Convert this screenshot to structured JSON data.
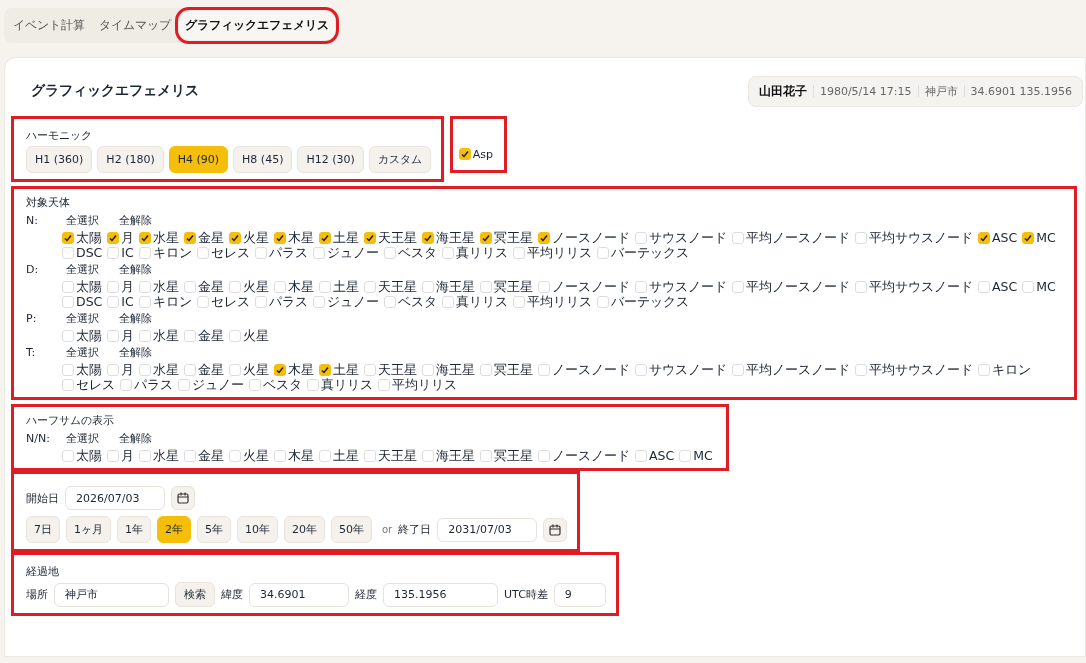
{
  "tabs": [
    {
      "label": "イベント計算",
      "selected": false,
      "highlighted": false
    },
    {
      "label": "タイムマップ",
      "selected": false,
      "highlighted": false
    },
    {
      "label": "グラフィックエフェメリス",
      "selected": true,
      "highlighted": true
    }
  ],
  "page_title": "グラフィックエフェメリス",
  "profile": {
    "name": "山田花子",
    "datetime": "1980/5/14 17:15",
    "place": "神戸市",
    "coords": "34.6901 135.1956"
  },
  "harmonic": {
    "label": "ハーモニック",
    "highlighted": true,
    "options": [
      {
        "label": "H1 (360)",
        "selected": false
      },
      {
        "label": "H2 (180)",
        "selected": false
      },
      {
        "label": "H4 (90)",
        "selected": true
      },
      {
        "label": "H8 (45)",
        "selected": false
      },
      {
        "label": "H12 (30)",
        "selected": false
      },
      {
        "label": "カスタム",
        "selected": false
      }
    ]
  },
  "asp": {
    "label": "Asp",
    "checked": true,
    "highlighted": true
  },
  "bodies": {
    "label": "対象天体",
    "highlighted": true,
    "groups": [
      {
        "label": "N:",
        "select_all": "全選択",
        "clear_all": "全解除",
        "items": [
          {
            "label": "太陽",
            "checked": true
          },
          {
            "label": "月",
            "checked": true
          },
          {
            "label": "水星",
            "checked": true
          },
          {
            "label": "金星",
            "checked": true
          },
          {
            "label": "火星",
            "checked": true
          },
          {
            "label": "木星",
            "checked": true
          },
          {
            "label": "土星",
            "checked": true
          },
          {
            "label": "天王星",
            "checked": true
          },
          {
            "label": "海王星",
            "checked": true
          },
          {
            "label": "冥王星",
            "checked": true
          },
          {
            "label": "ノースノード",
            "checked": true
          },
          {
            "label": "サウスノード",
            "checked": false
          },
          {
            "label": "平均ノースノード",
            "checked": false
          },
          {
            "label": "平均サウスノード",
            "checked": false
          },
          {
            "label": "ASC",
            "checked": true
          },
          {
            "label": "MC",
            "checked": true
          },
          {
            "label": "DSC",
            "checked": false
          },
          {
            "label": "IC",
            "checked": false
          },
          {
            "label": "キロン",
            "checked": false
          },
          {
            "label": "セレス",
            "checked": false
          },
          {
            "label": "パラス",
            "checked": false
          },
          {
            "label": "ジュノー",
            "checked": false
          },
          {
            "label": "ベスタ",
            "checked": false
          },
          {
            "label": "真リリス",
            "checked": false
          },
          {
            "label": "平均リリス",
            "checked": false
          },
          {
            "label": "バーテックス",
            "checked": false
          }
        ]
      },
      {
        "label": "D:",
        "select_all": "全選択",
        "clear_all": "全解除",
        "items": [
          {
            "label": "太陽",
            "checked": false
          },
          {
            "label": "月",
            "checked": false
          },
          {
            "label": "水星",
            "checked": false
          },
          {
            "label": "金星",
            "checked": false
          },
          {
            "label": "火星",
            "checked": false
          },
          {
            "label": "木星",
            "checked": false
          },
          {
            "label": "土星",
            "checked": false
          },
          {
            "label": "天王星",
            "checked": false
          },
          {
            "label": "海王星",
            "checked": false
          },
          {
            "label": "冥王星",
            "checked": false
          },
          {
            "label": "ノースノード",
            "checked": false
          },
          {
            "label": "サウスノード",
            "checked": false
          },
          {
            "label": "平均ノースノード",
            "checked": false
          },
          {
            "label": "平均サウスノード",
            "checked": false
          },
          {
            "label": "ASC",
            "checked": false
          },
          {
            "label": "MC",
            "checked": false
          },
          {
            "label": "DSC",
            "checked": false
          },
          {
            "label": "IC",
            "checked": false
          },
          {
            "label": "キロン",
            "checked": false
          },
          {
            "label": "セレス",
            "checked": false
          },
          {
            "label": "パラス",
            "checked": false
          },
          {
            "label": "ジュノー",
            "checked": false
          },
          {
            "label": "ベスタ",
            "checked": false
          },
          {
            "label": "真リリス",
            "checked": false
          },
          {
            "label": "平均リリス",
            "checked": false
          },
          {
            "label": "バーテックス",
            "checked": false
          }
        ]
      },
      {
        "label": "P:",
        "select_all": "全選択",
        "clear_all": "全解除",
        "items": [
          {
            "label": "太陽",
            "checked": false
          },
          {
            "label": "月",
            "checked": false
          },
          {
            "label": "水星",
            "checked": false
          },
          {
            "label": "金星",
            "checked": false
          },
          {
            "label": "火星",
            "checked": false
          }
        ]
      },
      {
        "label": "T:",
        "select_all": "全選択",
        "clear_all": "全解除",
        "items": [
          {
            "label": "太陽",
            "checked": false
          },
          {
            "label": "月",
            "checked": false
          },
          {
            "label": "水星",
            "checked": false
          },
          {
            "label": "金星",
            "checked": false
          },
          {
            "label": "火星",
            "checked": false
          },
          {
            "label": "木星",
            "checked": true
          },
          {
            "label": "土星",
            "checked": true
          },
          {
            "label": "天王星",
            "checked": false
          },
          {
            "label": "海王星",
            "checked": false
          },
          {
            "label": "冥王星",
            "checked": false
          },
          {
            "label": "ノースノード",
            "checked": false
          },
          {
            "label": "サウスノード",
            "checked": false
          },
          {
            "label": "平均ノースノード",
            "checked": false
          },
          {
            "label": "平均サウスノード",
            "checked": false
          },
          {
            "label": "キロン",
            "checked": false
          },
          {
            "label": "セレス",
            "checked": false
          },
          {
            "label": "パラス",
            "checked": false
          },
          {
            "label": "ジュノー",
            "checked": false
          },
          {
            "label": "ベスタ",
            "checked": false
          },
          {
            "label": "真リリス",
            "checked": false
          },
          {
            "label": "平均リリス",
            "checked": false
          }
        ]
      }
    ]
  },
  "halfsum": {
    "label": "ハーフサムの表示",
    "highlighted": true,
    "groups": [
      {
        "label": "N/N:",
        "select_all": "全選択",
        "clear_all": "全解除",
        "items": [
          {
            "label": "太陽",
            "checked": false
          },
          {
            "label": "月",
            "checked": false
          },
          {
            "label": "水星",
            "checked": false
          },
          {
            "label": "金星",
            "checked": false
          },
          {
            "label": "火星",
            "checked": false
          },
          {
            "label": "木星",
            "checked": false
          },
          {
            "label": "土星",
            "checked": false
          },
          {
            "label": "天王星",
            "checked": false
          },
          {
            "label": "海王星",
            "checked": false
          },
          {
            "label": "冥王星",
            "checked": false
          },
          {
            "label": "ノースノード",
            "checked": false
          },
          {
            "label": "ASC",
            "checked": false
          },
          {
            "label": "MC",
            "checked": false
          }
        ]
      }
    ]
  },
  "dates": {
    "highlighted": true,
    "start_label": "開始日",
    "start_value": "2026/07/03",
    "spans": [
      {
        "label": "7日",
        "selected": false
      },
      {
        "label": "1ヶ月",
        "selected": false
      },
      {
        "label": "1年",
        "selected": false
      },
      {
        "label": "2年",
        "selected": true
      },
      {
        "label": "5年",
        "selected": false
      },
      {
        "label": "10年",
        "selected": false
      },
      {
        "label": "20年",
        "selected": false
      },
      {
        "label": "50年",
        "selected": false
      }
    ],
    "or": "or",
    "end_label": "終了日",
    "end_value": "2031/07/03"
  },
  "location": {
    "label": "経過地",
    "highlighted": true,
    "place_label": "場所",
    "place_value": "神戸市",
    "search": "検索",
    "lat_label": "緯度",
    "lat_value": "34.6901",
    "lon_label": "経度",
    "lon_value": "135.1956",
    "utc_label": "UTC時差",
    "utc_value": "9"
  }
}
